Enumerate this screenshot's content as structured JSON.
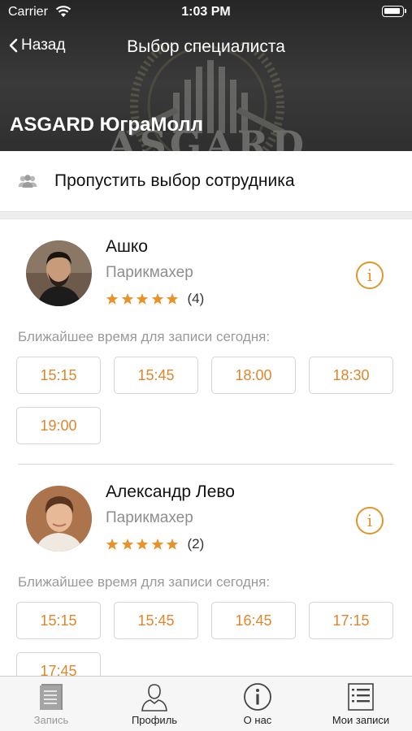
{
  "status_bar": {
    "carrier": "Carrier",
    "time": "1:03 PM"
  },
  "nav": {
    "back_label": "Назад",
    "title": "Выбор специалиста"
  },
  "header": {
    "salon_name": "ASGARD ЮграМолл",
    "background_logo_text": "ASGARD"
  },
  "skip": {
    "label": "Пропустить выбор сотрудника",
    "icon": "group-icon"
  },
  "nearest_label": "Ближайшее время для записи сегодня:",
  "specialists": [
    {
      "name": "Ашко",
      "role": "Парикмахер",
      "rating": 5,
      "reviews": "(4)",
      "slots": [
        "15:15",
        "15:45",
        "18:00",
        "18:30",
        "19:00"
      ]
    },
    {
      "name": "Александр Лево",
      "role": "Парикмахер",
      "rating": 5,
      "reviews": "(2)",
      "slots": [
        "15:15",
        "15:45",
        "16:45",
        "17:15",
        "17:45"
      ]
    }
  ],
  "tabs": [
    {
      "label": "Запись",
      "icon": "book-icon",
      "active": false
    },
    {
      "label": "Профиль",
      "icon": "profile-icon",
      "active": true
    },
    {
      "label": "О нас",
      "icon": "info-icon",
      "active": true
    },
    {
      "label": "Мои записи",
      "icon": "list-icon",
      "active": true
    }
  ],
  "colors": {
    "accent": "#e0862d",
    "header_bg": "#2f2f2f",
    "star": "#e8922a"
  }
}
